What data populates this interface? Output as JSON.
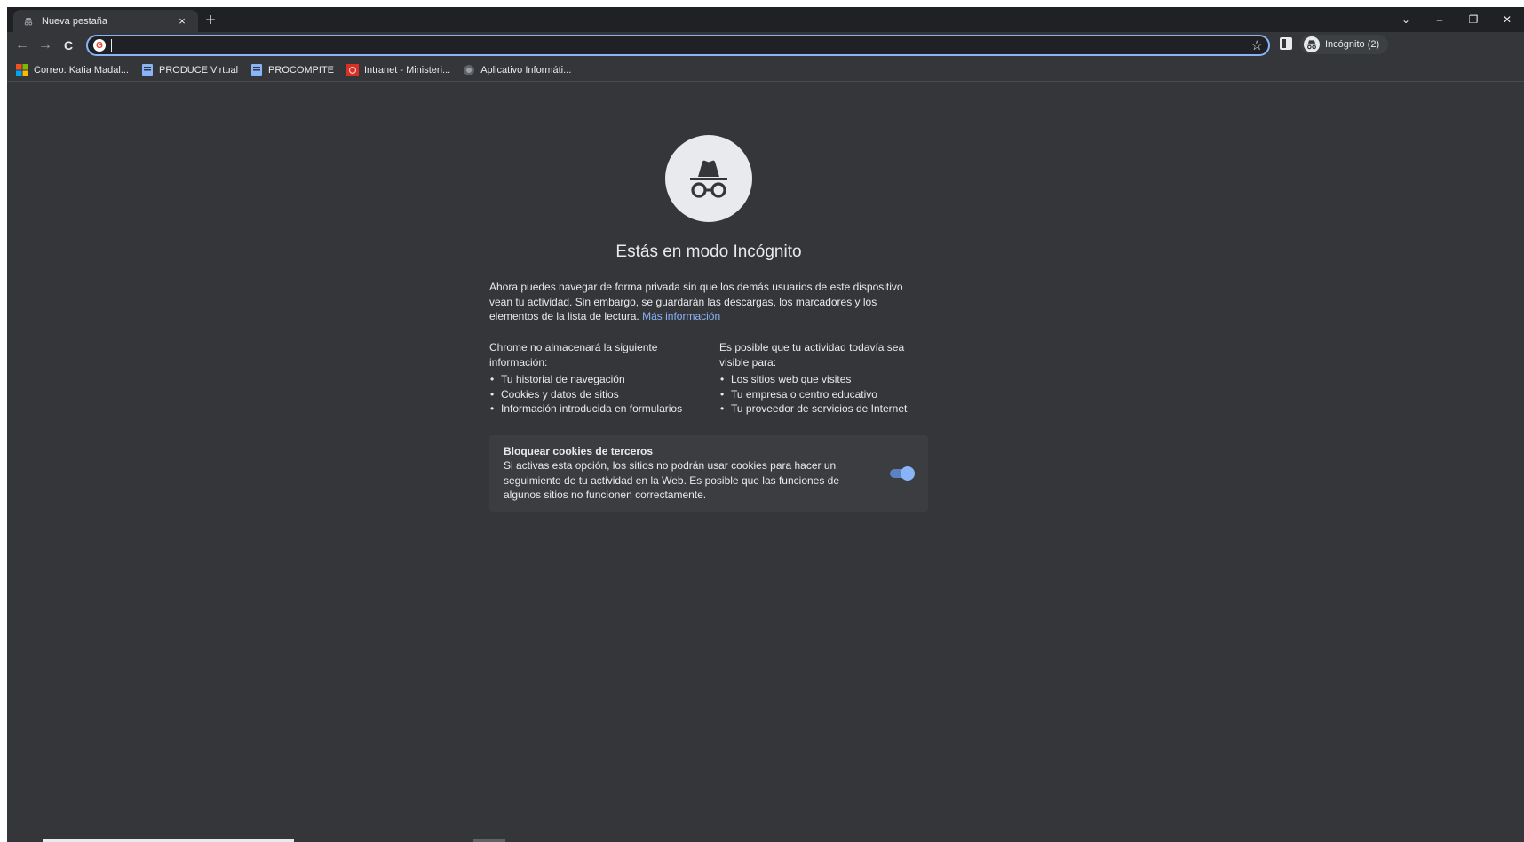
{
  "tab": {
    "title": "Nueva pestaña",
    "close": "×"
  },
  "newtab": {
    "label": "+"
  },
  "window": {
    "dropdown": "⌄",
    "minimize": "–",
    "restore": "❐",
    "close": "✕"
  },
  "toolbar": {
    "back": "←",
    "forward": "→",
    "reload": "C"
  },
  "omnibox": {
    "value": "",
    "placeholder": "",
    "star": "☆"
  },
  "profile": {
    "label": "Incógnito (2)"
  },
  "bookmarks": [
    {
      "label": "Correo: Katia Madal...",
      "icon": "microsoft-icon"
    },
    {
      "label": "PRODUCE Virtual",
      "icon": "page-icon"
    },
    {
      "label": "PROCOMPITE",
      "icon": "page-icon"
    },
    {
      "label": "Intranet - Ministeri...",
      "icon": "intranet-icon"
    },
    {
      "label": "Aplicativo Informáti...",
      "icon": "globe-icon"
    }
  ],
  "page": {
    "heading": "Estás en modo Incógnito",
    "intro": "Ahora puedes navegar de forma privada sin que los demás usuarios de este dispositivo vean tu actividad. Sin embargo, se guardarán las descargas, los marcadores y los elementos de la lista de lectura.",
    "learn_more": "Más información",
    "left_col": {
      "title": "Chrome no almacenará la siguiente información:",
      "items": [
        "Tu historial de navegación",
        "Cookies y datos de sitios",
        "Información introducida en formularios"
      ]
    },
    "right_col": {
      "title": "Es posible que tu actividad todavía sea visible para:",
      "items": [
        "Los sitios web que visites",
        "Tu empresa o centro educativo",
        "Tu proveedor de servicios de Internet"
      ]
    },
    "cookies": {
      "title": "Bloquear cookies de terceros",
      "description": "Si activas esta opción, los sitios no podrán usar cookies para hacer un seguimiento de tu actividad en la Web. Es posible que las funciones de algunos sitios no funcionen correctamente.",
      "enabled": true
    }
  },
  "colors": {
    "accent": "#8ab4f8",
    "background": "#35363a",
    "frame": "#202124"
  }
}
